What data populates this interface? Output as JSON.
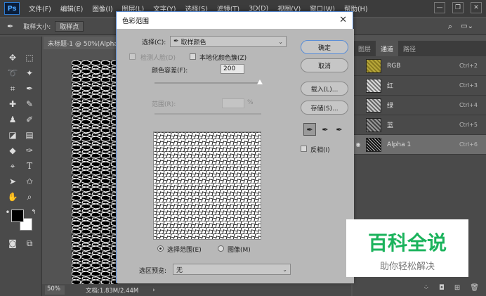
{
  "app": {
    "logo": "Ps"
  },
  "menubar": {
    "items": [
      "文件(F)",
      "编辑(E)",
      "图像(I)",
      "图层(L)",
      "文字(Y)",
      "选择(S)",
      "滤镜(T)",
      "3D(D)",
      "视图(V)",
      "窗口(W)",
      "帮助(H)"
    ]
  },
  "window_controls": {
    "minimize": "—",
    "restore": "❐",
    "close": "✕"
  },
  "options_bar": {
    "sample_size_label": "取样大小:",
    "sample_size_value": "取样点"
  },
  "document": {
    "tab_title": "未标题-1 @ 50%(Alpha..."
  },
  "status_bar": {
    "zoom": "50%",
    "info": "文档:1.83M/2.44M"
  },
  "channels_panel": {
    "tabs": [
      "图层",
      "通道",
      "路径"
    ],
    "active_tab": "通道",
    "channels": [
      {
        "name": "RGB",
        "shortcut": "Ctrl+2",
        "visible": false,
        "selected": false
      },
      {
        "name": "红",
        "shortcut": "Ctrl+3",
        "visible": false,
        "selected": false
      },
      {
        "name": "绿",
        "shortcut": "Ctrl+4",
        "visible": false,
        "selected": false
      },
      {
        "name": "蓝",
        "shortcut": "Ctrl+5",
        "visible": false,
        "selected": false
      },
      {
        "name": "Alpha 1",
        "shortcut": "Ctrl+6",
        "visible": true,
        "selected": true
      }
    ]
  },
  "dialog": {
    "title": "色彩范围",
    "select_label": "选择(C):",
    "select_value": "取样颜色",
    "detect_faces_label": "检测人脸(D)",
    "localized_label": "本地化颜色簇(Z)",
    "fuzziness_label": "颜色容差(F):",
    "fuzziness_value": "200",
    "range_label": "范围(R):",
    "range_unit": "%",
    "ok_label": "确定",
    "cancel_label": "取消",
    "load_label": "载入(L)...",
    "save_label": "存储(S)...",
    "invert_label": "反相(I)",
    "radio_selection_label": "选择范围(E)",
    "radio_image_label": "图像(M)",
    "preview_label": "选区预览:",
    "preview_value": "无"
  },
  "watermark": {
    "title": "百科全说",
    "subtitle": "助你轻松解决"
  },
  "colors": {
    "accent": "#1bb35c",
    "dialog_bg": "#b8b8b8",
    "app_bg": "#535353"
  }
}
